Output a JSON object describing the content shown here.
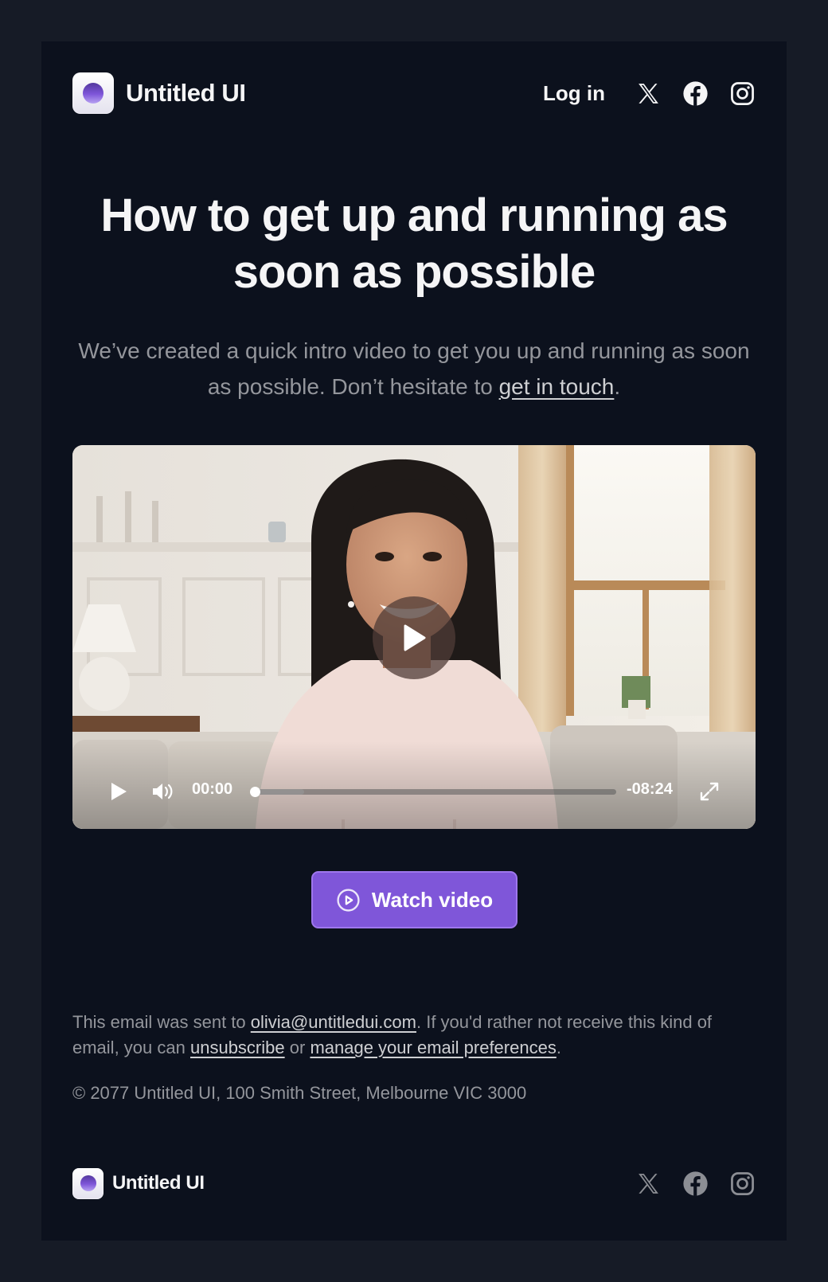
{
  "brand": {
    "name": "Untitled UI"
  },
  "header": {
    "login_label": "Log in",
    "social_icons": [
      "x-icon",
      "facebook-icon",
      "instagram-icon"
    ]
  },
  "hero": {
    "title": "How to get up and running as soon as possible",
    "subtitle_text": "We’ve created a quick intro video to get you up and running as soon as possible. Don’t hesitate to",
    "subtitle_link": "get in touch",
    "subtitle_end": "."
  },
  "video": {
    "current_time": "00:00",
    "remaining_time": "-08:24",
    "progress_fraction": 0.0,
    "buffered_fraction": 0.14
  },
  "cta": {
    "label": "Watch video",
    "color": "#7f56d9"
  },
  "footer": {
    "legal_pre": "This email was sent to",
    "email": "olivia@untitledui.com",
    "legal_mid": ". If you'd rather not receive this kind of email, you can",
    "unsubscribe": "unsubscribe",
    "or": "or",
    "manage_prefs": "manage your email preferences",
    "end": ".",
    "copyright": "© 2077 Untitled UI, 100 Smith Street, Melbourne VIC 3000",
    "brand_name": "Untitled UI"
  },
  "colors": {
    "page_bg": "#161b26",
    "card_bg": "#0c111d",
    "text_primary": "#f5f5f6",
    "text_muted": "#94969c",
    "accent": "#7f56d9"
  }
}
